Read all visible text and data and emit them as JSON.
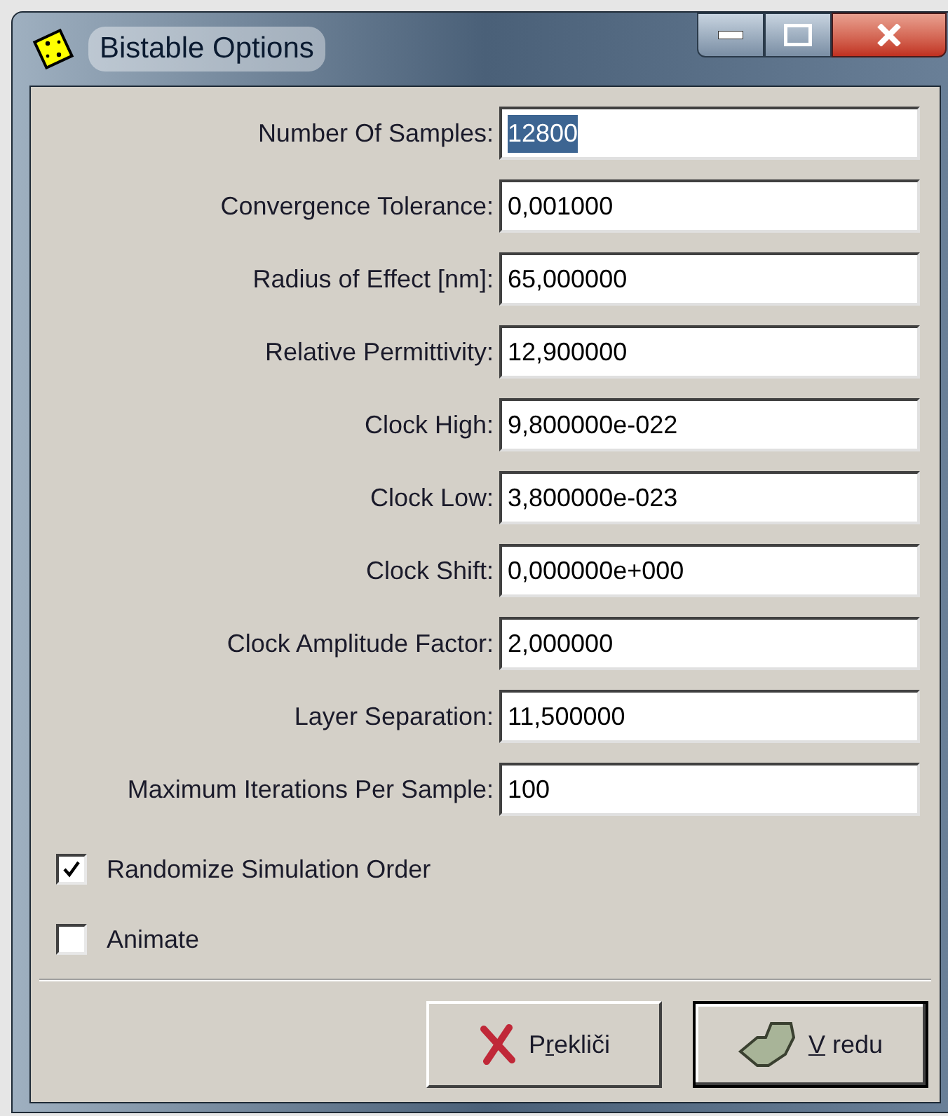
{
  "window": {
    "title": "Bistable Options"
  },
  "fields": [
    {
      "label": "Number Of Samples:",
      "value": "12800",
      "selected": true
    },
    {
      "label": "Convergence Tolerance:",
      "value": "0,001000",
      "selected": false
    },
    {
      "label": "Radius of Effect [nm]:",
      "value": "65,000000",
      "selected": false
    },
    {
      "label": "Relative Permittivity:",
      "value": "12,900000",
      "selected": false
    },
    {
      "label": "Clock High:",
      "value": "9,800000e-022",
      "selected": false
    },
    {
      "label": "Clock Low:",
      "value": "3,800000e-023",
      "selected": false
    },
    {
      "label": "Clock Shift:",
      "value": "0,000000e+000",
      "selected": false
    },
    {
      "label": "Clock Amplitude Factor:",
      "value": "2,000000",
      "selected": false
    },
    {
      "label": "Layer Separation:",
      "value": "11,500000",
      "selected": false
    },
    {
      "label": "Maximum Iterations Per Sample:",
      "value": "100",
      "selected": false
    }
  ],
  "checkboxes": [
    {
      "label": "Randomize Simulation Order",
      "checked": true
    },
    {
      "label": "Animate",
      "checked": false
    }
  ],
  "buttons": [
    {
      "kind": "cancel",
      "label_parts": [
        {
          "text": "P",
          "underlined": false
        },
        {
          "text": "r",
          "underlined": true
        },
        {
          "text": "ekliči",
          "underlined": false
        }
      ],
      "default": false
    },
    {
      "kind": "ok",
      "label_parts": [
        {
          "text": "V",
          "underlined": true
        },
        {
          "text": " redu",
          "underlined": false
        }
      ],
      "default": true
    }
  ]
}
